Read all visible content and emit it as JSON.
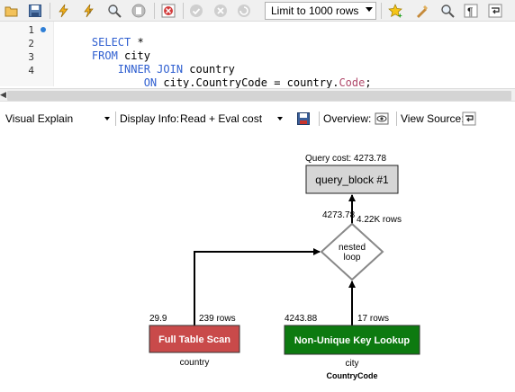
{
  "toolbar": {
    "icons": [
      "open-file-icon",
      "save-icon",
      "execute-icon",
      "execute-current-icon",
      "explain-icon",
      "stop-icon",
      "toggle-error-icon",
      "commit-icon",
      "rollback-icon",
      "autocommit-icon",
      "bookmark-icon",
      "beautify-icon",
      "find-icon",
      "invisible-chars-icon",
      "word-wrap-icon"
    ],
    "limit_label": "Limit to 1000 rows"
  },
  "editor": {
    "line_numbers": [
      "1",
      "2",
      "3",
      "4"
    ],
    "lines": [
      {
        "parts": [
          {
            "t": "SELECT",
            "c": "kw"
          },
          {
            "t": " *",
            "c": ""
          }
        ]
      },
      {
        "parts": [
          {
            "t": "FROM",
            "c": "kw"
          },
          {
            "t": " city",
            "c": ""
          }
        ]
      },
      {
        "parts": [
          {
            "t": "    INNER JOIN",
            "c": "kw"
          },
          {
            "t": " country",
            "c": ""
          }
        ]
      },
      {
        "parts": [
          {
            "t": "        ON",
            "c": "kw"
          },
          {
            "t": " city.CountryCode = country.",
            "c": ""
          },
          {
            "t": "Code",
            "c": "fn"
          },
          {
            "t": ";",
            "c": ""
          }
        ]
      }
    ]
  },
  "explain_bar": {
    "view_select": "Visual Explain",
    "display_info_label": "Display Info:",
    "display_info_value": "Read + Eval cost",
    "overview_label": "Overview:",
    "view_source_label": "View Source:"
  },
  "diagram": {
    "query_cost_label": "Query cost: 4273.78",
    "query_block_label": "query_block #1",
    "nested_loop_cost": "4273.78",
    "nested_loop_rows": "4.22K rows",
    "nested_loop_label_1": "nested",
    "nested_loop_label_2": "loop",
    "left_cost": "29.9",
    "left_rows": "239 rows",
    "left_box_label": "Full Table Scan",
    "left_table": "country",
    "right_cost": "4243.88",
    "right_rows": "17 rows",
    "right_box_label": "Non-Unique Key Lookup",
    "right_table": "city",
    "right_key": "CountryCode",
    "colors": {
      "full_scan_fill": "#c94a4a",
      "key_lookup_fill": "#0d7a10",
      "query_block_fill": "#d6d6d6"
    }
  }
}
